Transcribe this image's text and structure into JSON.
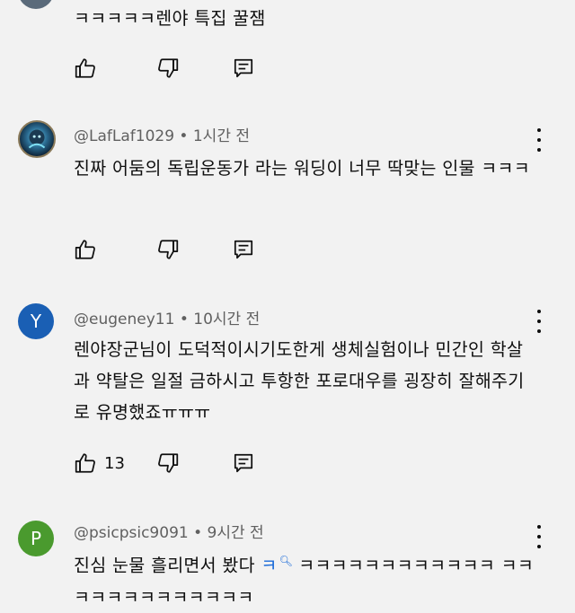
{
  "comments": [
    {
      "text": "ㅋㅋㅋㅋㅋ렌야 특집 꿀잼",
      "like_count": ""
    },
    {
      "author": "@LafLaf1029",
      "time": "1시간 전",
      "text": "진짜 어둠의 독립운동가 라는 워딩이 너무 딱맞는 인물 ㅋㅋㅋ",
      "like_count": ""
    },
    {
      "author": "@eugeney11",
      "time": "10시간 전",
      "avatar_letter": "Y",
      "avatar_color": "#1a5fb4",
      "text": "렌야장군님이 도덕적이시기도한게 생체실험이나 민간인 학살과 약탈은 일절 금하시고 투항한 포로대우를 굉장히 잘해주기로 유명했죠ㅠㅠㅠ",
      "like_count": "13"
    },
    {
      "author": "@psicpsic9091",
      "time": "9시간 전",
      "avatar_letter": "P",
      "avatar_color": "#4a9a2e",
      "text_link": "ㅋ",
      "text_prefix": "진심 눈물 흘리면서 봤다 ",
      "text_rest": "ㅋㅋㅋㅋㅋㅋㅋㅋㅋㅋㅋㅋ ㅋㅋㅋㅋㅋㅋㅋㅋㅋㅋㅋㅋㅋ",
      "like_count": ""
    }
  ],
  "icons": {
    "like": "thumbs-up-icon",
    "dislike": "thumbs-down-icon",
    "reply": "reply-comment-icon",
    "more": "more-vert-icon",
    "search": "search-icon"
  },
  "colors": {
    "background": "#f2f2f2",
    "meta_text": "#606060",
    "link": "#1a6ad8"
  }
}
